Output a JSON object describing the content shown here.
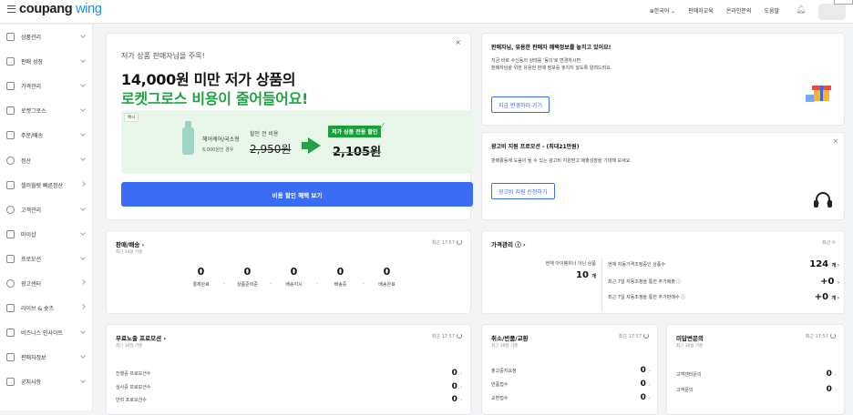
{
  "header": {
    "logo_main": "coupang",
    "logo_accent": "wing",
    "nav": [
      "⊕한국어 ⌄",
      "판매자교육",
      "온라인문의",
      "도움말"
    ],
    "bell_icon": "bell-icon"
  },
  "sidebar": {
    "items": [
      {
        "label": "상품관리",
        "icon": "box-icon",
        "chevron": "down"
      },
      {
        "label": "판매 성장",
        "icon": "growth-icon",
        "chevron": "down"
      },
      {
        "label": "가격관리",
        "icon": "price-tag-icon",
        "chevron": "down"
      },
      {
        "label": "로켓그로스",
        "icon": "rocket-icon",
        "chevron": "down"
      },
      {
        "label": "주문/배송",
        "icon": "truck-icon",
        "chevron": "down"
      },
      {
        "label": "정산",
        "icon": "coin-icon",
        "chevron": "down"
      },
      {
        "label": "셀러월렛 빠른정산",
        "icon": "wallet-icon",
        "chevron": "right"
      },
      {
        "label": "고객관리",
        "icon": "smile-icon",
        "chevron": "down"
      },
      {
        "label": "마이샵",
        "icon": "shop-icon",
        "chevron": "down"
      },
      {
        "label": "프로모션",
        "icon": "promotion-icon",
        "chevron": "down"
      },
      {
        "label": "광고센터",
        "icon": "ad-icon",
        "chevron": "right"
      },
      {
        "label": "라이브 & 숏츠",
        "icon": "live-icon",
        "chevron": "right"
      },
      {
        "label": "비즈니스 인사이트",
        "icon": "insight-icon",
        "chevron": "down"
      },
      {
        "label": "판매자정보",
        "icon": "user-icon",
        "chevron": "down"
      },
      {
        "label": "공지사항",
        "icon": "megaphone-icon",
        "chevron": "down"
      }
    ]
  },
  "promo": {
    "close": "×",
    "subtitle": "저가 상품 판매자님을 주목!",
    "headline1": "14,000원 미만 저가 상품의",
    "headline2": "로켓그로스 비용이 줄어들어요!",
    "example_tag": "예시",
    "product_name": "헤어케어/국소형",
    "product_cond": "6,000원인 경우",
    "before_label": "할인 전 비용",
    "before_price": "2,950원",
    "discount_label": "저가 상품 전용 할인",
    "after_price": "2,105원",
    "button": "비용 할인 혜택 보기"
  },
  "info_card": {
    "title": "판매자님, 유용한 판매자 혜택정보를 놓치고 있어요!",
    "desc1": "지금 바로 수신동의 상태를 '동의'로 변경하시면",
    "desc2": "판매자님을 위한 유용한 판매 정보를 놓치지 않도록 알려드려요.",
    "button": "지금 변경하러 가기"
  },
  "ad_card": {
    "close": "×",
    "title": "광고비 지원 프로모션 - (최대21만원)",
    "desc": "판매활동에 도움이 될 수 있는 광고비 지원받고 매출성장을 기대해 보세요.",
    "button": "광고비 지원 신청하기"
  },
  "sales_card": {
    "title": "판매/배송 ›",
    "sub": "최근 14일 기준",
    "updated": "최근 17:57",
    "stats": [
      {
        "value": "0",
        "label": "결제완료"
      },
      {
        "value": "0",
        "label": "상품준비중"
      },
      {
        "value": "0",
        "label": "배송지시"
      },
      {
        "value": "0",
        "label": "배송중"
      },
      {
        "value": "0",
        "label": "배송완료"
      }
    ],
    "arrow": "›"
  },
  "price_card": {
    "title": "가격관리 ⓘ ›",
    "updated": "최근 ⟳",
    "left_label": "현재 아이템위너 아닌 상품",
    "left_value": "10",
    "left_unit": "개",
    "rows": [
      {
        "label": "현재 자동가격조정중인 상품수",
        "value": "124",
        "unit": "개 ›"
      },
      {
        "label": "최근 7일 자동조정을 통한 추가매출 ⓘ",
        "value": "+0",
        "unit": "›"
      },
      {
        "label": "최근 7일 자동조정을 통한 추가판매수 ⓘ",
        "value": "+0",
        "unit": "개 ›"
      }
    ]
  },
  "free_exposure": {
    "title": "무료노출 프로모션 ›",
    "sub": "최근 30일 기준",
    "updated": "최근 17:57",
    "rows": [
      {
        "label": "진행중 프로모션수",
        "value": "0"
      },
      {
        "label": "심사중 프로모션수",
        "value": "0"
      },
      {
        "label": "반려 프로모션수",
        "value": "0"
      }
    ]
  },
  "cancel_card": {
    "title": "취소/반품/교환",
    "sub": "최근 30일 기준",
    "updated": "최근 17:57",
    "rows": [
      {
        "label": "출고중지요청",
        "value": "0"
      },
      {
        "label": "반품접수",
        "value": "0"
      },
      {
        "label": "교환접수",
        "value": "0"
      }
    ]
  },
  "unanswered_card": {
    "title": "미답변문의",
    "sub": "최근 30일 기준",
    "updated": "최근 17:57",
    "rows": [
      {
        "label": "고객센터문의",
        "value": "0"
      },
      {
        "label": "고객문의",
        "value": "0"
      }
    ]
  }
}
